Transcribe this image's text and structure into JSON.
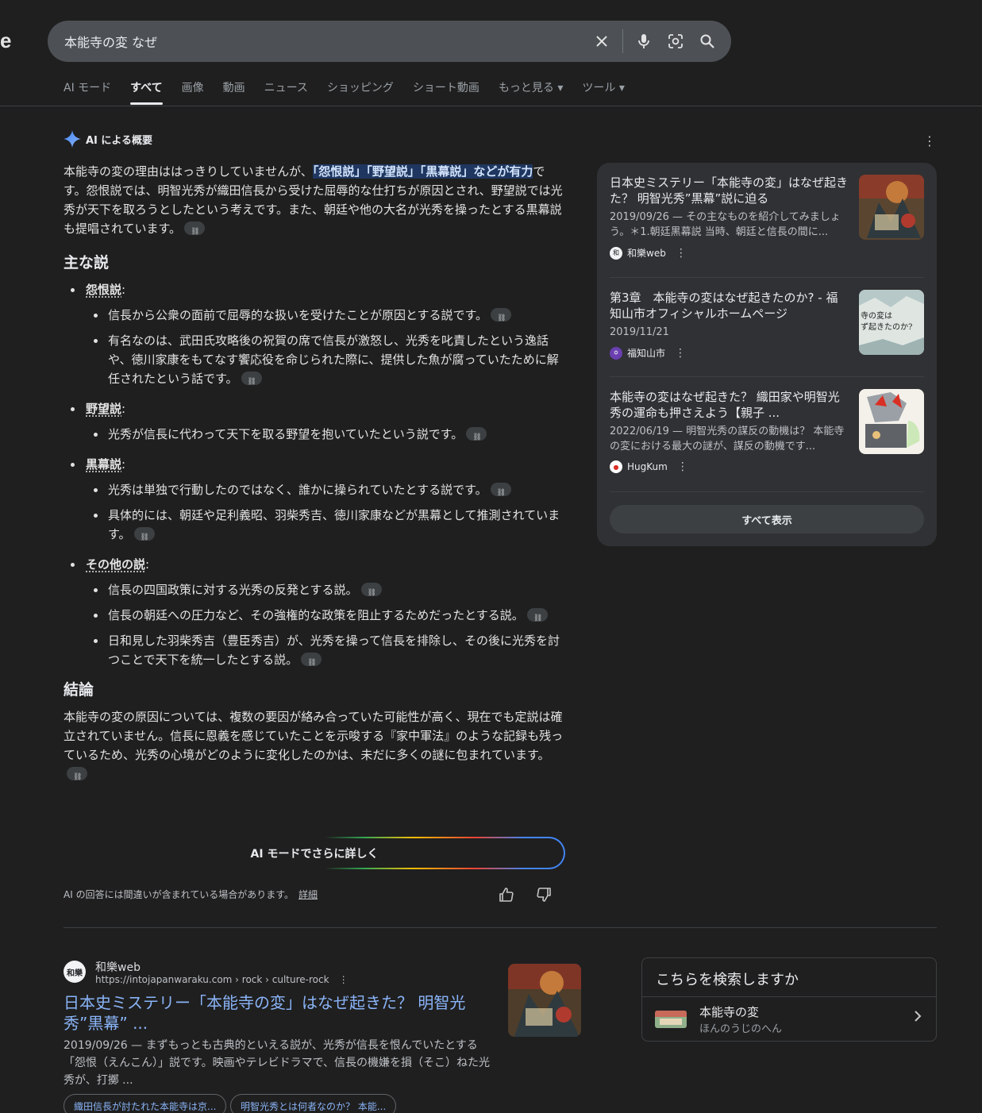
{
  "logo_fragment": "e",
  "search": {
    "query": "本能寺の変 なぜ",
    "icons": [
      "close-icon",
      "mic-icon",
      "lens-icon",
      "search-icon"
    ]
  },
  "tabs": [
    "AI モード",
    "すべて",
    "画像",
    "動画",
    "ニュース",
    "ショッピング",
    "ショート動画",
    "もっと見る ▾",
    "ツール ▾"
  ],
  "active_tab": "すべて",
  "ai_overview": {
    "heading": "AI による概要",
    "intro_a": "本能寺の変の理由ははっきりしていませんが、",
    "intro_hl": "「怨恨説」「野望説」「黒幕説」などが有力",
    "intro_b": "です。怨恨説では、明智光秀が織田信長から受けた屈辱的な仕打ちが原因とされ、野望説では光秀が天下を取ろうとしたという考えです。また、朝廷や他の大名が光秀を操ったとする黒幕説も提唱されています。",
    "section_main": "主な説",
    "theories": [
      {
        "name": "怨恨説",
        "points": [
          "信長から公衆の面前で屈辱的な扱いを受けたことが原因とする説です。",
          "有名なのは、武田氏攻略後の祝賀の席で信長が激怒し、光秀を叱責したという逸話や、徳川家康をもてなす饗応役を命じられた際に、提供した魚が腐っていたために解任されたという話です。"
        ]
      },
      {
        "name": "野望説",
        "points": [
          "光秀が信長に代わって天下を取る野望を抱いていたという説です。"
        ]
      },
      {
        "name": "黒幕説",
        "points": [
          "光秀は単独で行動したのではなく、誰かに操られていたとする説です。",
          "具体的には、朝廷や足利義昭、羽柴秀吉、徳川家康などが黒幕として推測されています。"
        ]
      },
      {
        "name": "その他の説",
        "points": [
          "信長の四国政策に対する光秀の反発とする説。",
          "信長の朝廷への圧力など、その強権的な政策を阻止するためだったとする説。",
          "日和見した羽柴秀吉（豊臣秀吉）が、光秀を操って信長を排除し、その後に光秀を討つことで天下を統一したとする説。"
        ]
      }
    ],
    "section_conclusion": "結論",
    "conclusion": "本能寺の変の原因については、複数の要因が絡み合っていた可能性が高く、現在でも定説は確立されていません。信長に恩義を感じていたことを示唆する『家中軍法』のような記録も残っているため、光秀の心境がどのように変化したのかは、未だに多くの謎に包まれています。",
    "ai_mode_button": "AI モードでさらに詳しく",
    "disclaimer": "AI の回答には間違いが含まれている場合があります。",
    "disclaimer_link": "詳細"
  },
  "sources": [
    {
      "title": "日本史ミステリー「本能寺の変」はなぜ起きた？ 明智光秀”黒幕”説に迫る",
      "snippet": "2019/09/26 — その主なものを紹介してみましょう。＊1.朝廷黒幕説 当時、朝廷と信長の間に...",
      "site": "和樂web"
    },
    {
      "title": "第3章　本能寺の変はなぜ起きたのか? - 福知山市オフィシャルホームページ",
      "snippet": "2019/11/21",
      "site": "福知山市"
    },
    {
      "title": "本能寺の変はなぜ起きた？ 織田家や明智光秀の運命も押さえよう【親子 ...",
      "snippet": "2022/06/19 — 明智光秀の謀反の動機は？ 本能寺の変における最大の謎が、謀反の動機です...",
      "site": "HugKum"
    }
  ],
  "sources_show_all": "すべて表示",
  "thumb_text_2": "寺の変は\nず起きたのか?\n「光は」から見る関係の真相",
  "result": {
    "site_name": "和樂web",
    "url": "https://intojapanwaraku.com › rock › culture-rock",
    "favicon_text": "和樂",
    "title": "日本史ミステリー「本能寺の変」はなぜ起きた？ 明智光秀”黒幕” ...",
    "snippet": "2019/09/26 — まずもっとも古典的といえる説が、光秀が信長を恨んでいたとする「怨恨（えんこん）」説です。映画やテレビドラマで、信長の機嫌を損（そこ）ねた光秀が、打擲 ...",
    "chips": [
      "織田信長が討たれた本能寺は京...",
      "明智光秀とは何者なのか？ 本能..."
    ]
  },
  "did_you_mean": {
    "heading": "こちらを検索しますか",
    "title": "本能寺の変",
    "reading": "ほんのうじのへん"
  },
  "colors": {
    "background": "#1f1f1f",
    "link": "#8ab4f8",
    "highlight": "#1f3760"
  }
}
